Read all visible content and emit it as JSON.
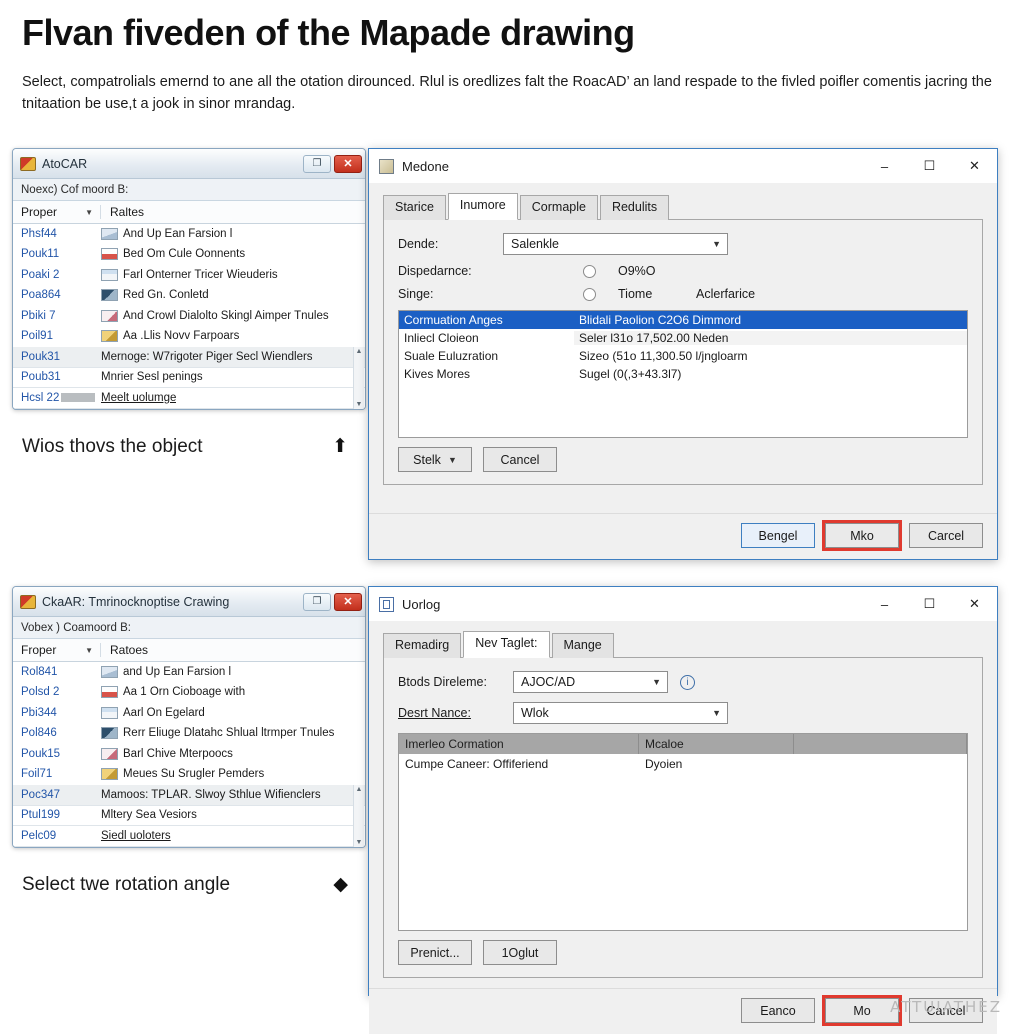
{
  "article": {
    "title": "Flvan fiveden of the Mapade drawing",
    "body": "Select, compatrolials emernd to ane all the otation dirounced. Rlul is oredlizes falt the RoacAD’ an land respade to the fivled poifler comentis jacring the tnitaation be use,t a jook in sinor mrandag."
  },
  "watermark": "ATTUIATHEZ",
  "cad_top": {
    "title": "AtoCAR",
    "icon": "autocad-app-icon",
    "restore_label": "❐",
    "close_label": "✕",
    "menubar": "Noexc) Cof moord B:",
    "columns": {
      "col1": "Proper",
      "col2": "Raltes"
    },
    "rows": [
      {
        "id": "Phsf44",
        "label": "And Up Ean Farsion l"
      },
      {
        "id": "Pouk11",
        "label": "Bed Om Cule Oonnents"
      },
      {
        "id": "Poaki 2",
        "label": "Farl Onterner Tricer Wieuderis"
      },
      {
        "id": "Poa864",
        "label": "Red Gn. Conletd"
      },
      {
        "id": "Pbiki 7",
        "label": "And Crowl Dialolto Skingl Aimper Tnules"
      },
      {
        "id": "Poil91",
        "label": "Aa .Llis Novv Farpoars"
      },
      {
        "id": "Pouk31",
        "label": "Mernoge: W7rigoter Piger Secl Wiendlers"
      },
      {
        "id": "Poub31",
        "label": "Mnrier Sesl penings"
      },
      {
        "id": "Hcsl 22",
        "label": "Meelt uolumge"
      }
    ]
  },
  "cad_bottom": {
    "title": "CkaAR: Tmrinocknoptise Crawing",
    "icon": "autocad-app-icon",
    "restore_label": "❐",
    "close_label": "✕",
    "menubar": "Vobex ) Coamoord B:",
    "columns": {
      "col1": "Froper",
      "col2": "Ratoes"
    },
    "rows": [
      {
        "id": "Rol841",
        "label": "and Up Ean Farsion l"
      },
      {
        "id": "Polsd 2",
        "label": "Aa 1 Orn Cioboage with"
      },
      {
        "id": "Pbi344",
        "label": "Aarl On Egelard"
      },
      {
        "id": "Pol846",
        "label": "Rerr Eliuge Dlatahc Shlual ltrmper Tnules"
      },
      {
        "id": "Pouk15",
        "label": "Barl Chive Mterpoocs"
      },
      {
        "id": "Foil71",
        "label": "Meues Su Srugler Pemders"
      },
      {
        "id": "Poc347",
        "label": "Mamoos: TPLAR. Slwoy Sthlue Wifienclers"
      },
      {
        "id": "Ptul199",
        "label": "Mltery Sea Vesiors"
      },
      {
        "id": "Pelc09",
        "label": "Siedl uoloters"
      }
    ]
  },
  "caption_top": {
    "text": "Wios thovs the object",
    "marker": "⬆",
    "marker_name": "up-arrow-marker"
  },
  "caption_bottom": {
    "text": "Select twe rotation angle",
    "marker": "◆",
    "marker_name": "diamond-marker"
  },
  "dialog_top": {
    "title": "Medone",
    "minimize": "–",
    "maximize": "☐",
    "close": "✕",
    "tabs": [
      {
        "label": "Starice",
        "active": false
      },
      {
        "label": "Inumore",
        "active": true
      },
      {
        "label": "Cormaple",
        "active": false
      },
      {
        "label": "Redulits",
        "active": false
      }
    ],
    "fields": {
      "dende_label": "Dende:",
      "dende_value": "Salenkle",
      "dispedarnce_label": "Dispedarnce:",
      "dispedarnce_option": "O9%O",
      "singe_label": "Singe:",
      "singe_option_1": "Tiome",
      "singe_option_2": "Aclerfarice"
    },
    "list_columns": {
      "c1": "Cormuation Anges",
      "c2": "Blidali Paolion C2O6 Dimmord"
    },
    "list_rows": [
      {
        "c1": "Cormuation Anges",
        "c2": "Blidali Paolion C2O6 Dimmord",
        "selected": true,
        "boxed": false
      },
      {
        "c1": "Inliecl Cloieon",
        "c2": "Seler l31o 17,502.00 Neden",
        "selected": false,
        "boxed": true
      },
      {
        "c1": "Suale Euluzration",
        "c2": "Sizeo (51o 11,300.50 l/jngloarm",
        "selected": false,
        "boxed": false
      },
      {
        "c1": "Kives Mores",
        "c2": "Sugel (0(,3+43.3l7)",
        "selected": false,
        "boxed": false
      }
    ],
    "inline_buttons": [
      {
        "label": "Stelk",
        "split": true
      },
      {
        "label": "Cancel",
        "split": false
      }
    ],
    "footer_buttons": [
      {
        "label": "Bengel",
        "style": "primary"
      },
      {
        "label": "Mko",
        "style": "redring"
      },
      {
        "label": "Carcel",
        "style": "normal"
      }
    ]
  },
  "dialog_bottom": {
    "title": "Uorlog",
    "minimize": "–",
    "maximize": "☐",
    "close": "✕",
    "tabs": [
      {
        "label": "Remadirg",
        "active": false
      },
      {
        "label": "Nev Taglet:",
        "active": true
      },
      {
        "label": "Mange",
        "active": false
      }
    ],
    "fields": {
      "brods_label": "Btods Direleme:",
      "brods_value": "AJOC/AD",
      "desrt_label": "Desrt Nance:",
      "desrt_value": "Wlok",
      "info_icon": "info-icon"
    },
    "grid_columns": {
      "c1": "Imerleo Cormation",
      "c2": "Mcaloe",
      "c3": ""
    },
    "grid_rows": [
      {
        "c1": "Cumpe Caneer: Offiferiend",
        "c2": "Dyoien",
        "c3": ""
      }
    ],
    "inline_buttons": [
      {
        "label": "Prenict...",
        "split": false
      },
      {
        "label": "1Oglut",
        "split": false
      }
    ],
    "footer_buttons": [
      {
        "label": "Eanco",
        "style": "normal"
      },
      {
        "label": "Mo",
        "style": "redring"
      },
      {
        "label": "Cancel",
        "style": "normal"
      }
    ]
  },
  "colors": {
    "selection_blue": "#1b5fc4",
    "dialog_border_blue": "#3e7fc1",
    "highlight_red": "#e03a2f",
    "link_blue": "#2255a8",
    "close_red": "#c22f1c"
  }
}
